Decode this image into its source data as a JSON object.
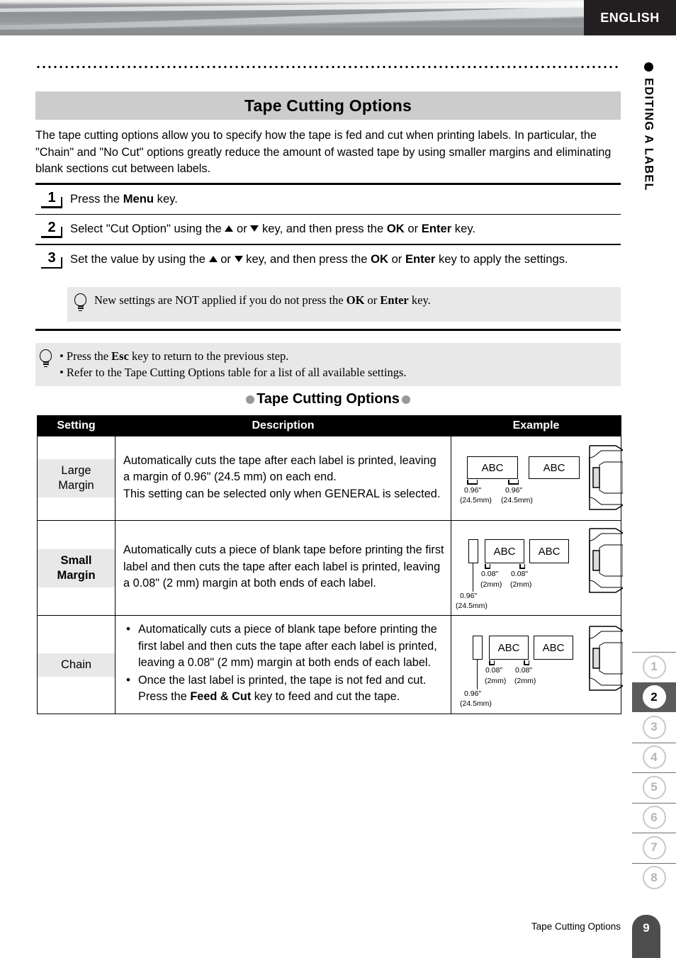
{
  "header": {
    "language_badge": "ENGLISH",
    "chapter_label": "EDITING A LABEL"
  },
  "page": {
    "title": "Tape Cutting Options",
    "intro": "The tape cutting options allow you to specify how the tape is fed and cut when printing labels. In particular, the \"Chain\" and \"No Cut\" options greatly reduce the amount of wasted tape by using smaller margins and eliminating blank sections cut between labels."
  },
  "steps": [
    {
      "number": "1",
      "parts": [
        {
          "t": "Press the ",
          "b": false
        },
        {
          "t": "Menu",
          "b": true
        },
        {
          "t": " key.",
          "b": false
        }
      ]
    },
    {
      "number": "2",
      "parts": [
        {
          "t": "Select \"Cut Option\" using the ",
          "b": false
        },
        {
          "t": "▲",
          "icon": "arrow-up"
        },
        {
          "t": " or ",
          "b": false
        },
        {
          "t": "▼",
          "icon": "arrow-down"
        },
        {
          "t": " key, and then press the ",
          "b": false
        },
        {
          "t": "OK",
          "b": true
        },
        {
          "t": " or ",
          "b": false
        },
        {
          "t": "Enter",
          "b": true
        },
        {
          "t": " key.",
          "b": false
        }
      ]
    },
    {
      "number": "3",
      "parts": [
        {
          "t": "Set the value by using the ",
          "b": false
        },
        {
          "t": "▲",
          "icon": "arrow-up"
        },
        {
          "t": " or ",
          "b": false
        },
        {
          "t": "▼",
          "icon": "arrow-down"
        },
        {
          "t": " key, and then press the ",
          "b": false
        },
        {
          "t": "OK",
          "b": true
        },
        {
          "t": " or ",
          "b": false
        },
        {
          "t": "Enter",
          "b": true
        },
        {
          "t": " key to apply the settings.",
          "b": false
        }
      ]
    }
  ],
  "notes": {
    "inline_note": {
      "icon": "lightbulb-icon",
      "parts": [
        {
          "t": "New settings are NOT applied if you do not press the ",
          "b": false
        },
        {
          "t": "OK",
          "b": true
        },
        {
          "t": " or ",
          "b": false
        },
        {
          "t": "Enter",
          "b": true
        },
        {
          "t": " key.",
          "b": false
        }
      ]
    },
    "tip_note": {
      "icon": "lightbulb-icon",
      "lines": [
        [
          {
            "t": "• Press the ",
            "b": false
          },
          {
            "t": "Esc",
            "b": true
          },
          {
            "t": " key to return to the previous step.",
            "b": false
          }
        ],
        [
          {
            "t": "• Refer to the Tape Cutting Options table for a list of all available settings.",
            "b": false
          }
        ]
      ]
    }
  },
  "table": {
    "title": "Tape Cutting Options",
    "columns": [
      "Setting",
      "Description",
      "Example"
    ],
    "rows": [
      {
        "setting": "Large\nMargin",
        "setting_bold": false,
        "description_lines": [
          "Automatically cuts the tape after each label is printed, leaving a margin of 0.96\" (24.5 mm) on each end.",
          "This setting can be selected only when GENERAL is selected."
        ],
        "description_bulleted": false,
        "example": {
          "labels": [
            "ABC",
            "ABC"
          ],
          "blank_tape": false,
          "dims": [
            "0.96\"",
            "(24.5mm)",
            "0.96\"",
            "(24.5mm)"
          ]
        }
      },
      {
        "setting": "Small\nMargin",
        "setting_bold": true,
        "description_lines": [
          "Automatically cuts a piece of blank tape before printing the first label and then cuts the tape after each label is printed, leaving a 0.08\" (2 mm) margin at both ends of each label."
        ],
        "description_bulleted": false,
        "example": {
          "labels": [
            "ABC",
            "ABC"
          ],
          "blank_tape": true,
          "dims": [
            "0.08\"",
            "(2mm)",
            "0.08\"",
            "(2mm)",
            "0.96\"",
            "(24.5mm)"
          ]
        }
      },
      {
        "setting": "Chain",
        "setting_bold": false,
        "description_bulleted": true,
        "description_bullets": [
          [
            {
              "t": "Automatically cuts a piece of blank tape before printing the first label and then cuts the tape after each label is printed, leaving a 0.08\" (2 mm) margin at both ends of each label.",
              "b": false
            }
          ],
          [
            {
              "t": "Once the last label is printed, the tape is not fed and cut. Press the ",
              "b": false
            },
            {
              "t": "Feed & Cut",
              "b": true
            },
            {
              "t": " key to feed and cut the tape.",
              "b": false
            }
          ]
        ],
        "example": {
          "labels": [
            "ABC",
            "ABC"
          ],
          "blank_tape": true,
          "dims": [
            "0.08\"",
            "(2mm)",
            "0.08\"",
            "(2mm)",
            "0.96\"",
            "(24.5mm)"
          ]
        }
      }
    ]
  },
  "sidebar_tabs": [
    {
      "label": "1",
      "active": false
    },
    {
      "label": "2",
      "active": true
    },
    {
      "label": "3",
      "active": false
    },
    {
      "label": "4",
      "active": false
    },
    {
      "label": "5",
      "active": false
    },
    {
      "label": "6",
      "active": false
    },
    {
      "label": "7",
      "active": false
    },
    {
      "label": "8",
      "active": false
    }
  ],
  "footer": {
    "text": "Tape Cutting Options",
    "page_number": "9"
  },
  "colors": {
    "title_bar": "#cccccc",
    "note_bg": "#e8e8e8",
    "table_header_bg": "#000000",
    "setting_cell_bg": "#e8e8e8",
    "active_tab_bg": "#5b5b5b",
    "page_tab_bg": "#4d4d4d",
    "badge_bg": "#231f20"
  }
}
